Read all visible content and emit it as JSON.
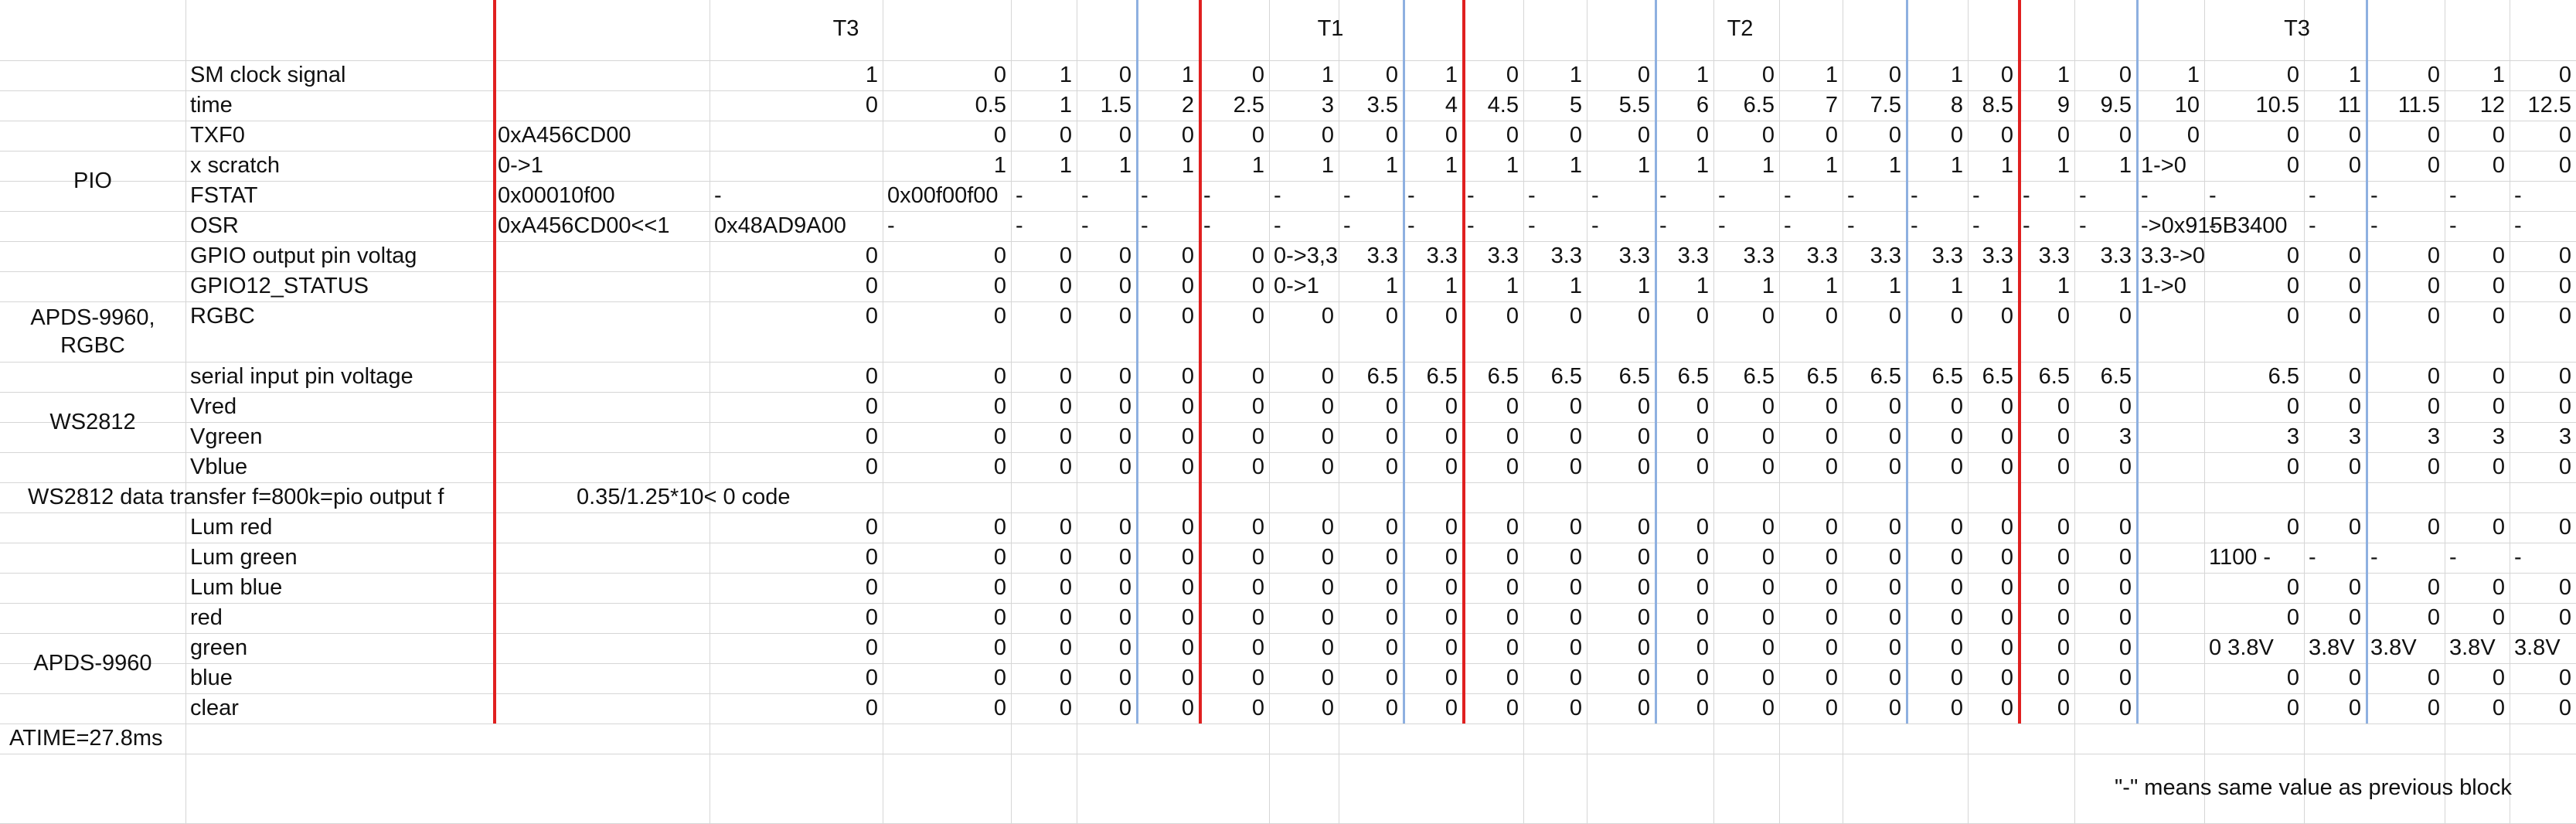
{
  "phases": [
    "T3",
    "T1",
    "T2",
    "T3"
  ],
  "sections": [
    "PIO",
    "APDS-9960,\nRGBC",
    "WS2812",
    "APDS-9960"
  ],
  "rows": [
    {
      "label": "SM clock signal",
      "cells": [
        "",
        "1",
        "0",
        "1",
        "0",
        "1",
        "0",
        "1",
        "0",
        "1",
        "0",
        "1",
        "0",
        "1",
        "0",
        "1",
        "0",
        "1",
        "0",
        "1",
        "0",
        "1",
        "0",
        "1",
        "0",
        "1",
        "0"
      ]
    },
    {
      "label": "time",
      "cells": [
        "",
        "0",
        "0.5",
        "1",
        "1.5",
        "2",
        "2.5",
        "3",
        "3.5",
        "4",
        "4.5",
        "5",
        "5.5",
        "6",
        "6.5",
        "7",
        "7.5",
        "8",
        "8.5",
        "9",
        "9.5",
        "10",
        "10.5",
        "11",
        "11.5",
        "12",
        "12.5"
      ]
    },
    {
      "label": "TXF0",
      "cells": [
        "0xA456CD00",
        "",
        "0",
        "0",
        "0",
        "0",
        "0",
        "0",
        "0",
        "0",
        "0",
        "0",
        "0",
        "0",
        "0",
        "0",
        "0",
        "0",
        "0",
        "0",
        "0",
        "0",
        "0",
        "0",
        "0",
        "0",
        "0"
      ]
    },
    {
      "label": "x  scratch",
      "cells": [
        "0->1",
        "",
        "1",
        "1",
        "1",
        "1",
        "1",
        "1",
        "1",
        "1",
        "1",
        "1",
        "1",
        "1",
        "1",
        "1",
        "1",
        "1",
        "1",
        "1",
        "1",
        "1->0",
        "0",
        "0",
        "0",
        "0",
        "0"
      ]
    },
    {
      "label": "FSTAT",
      "cells": [
        "0x00010f00",
        "-",
        "0x00f00f00",
        "-",
        "-",
        "-",
        "-",
        "-",
        "-",
        "-",
        "-",
        "-",
        "-",
        "-",
        "-",
        "-",
        "-",
        "-",
        "-",
        "-",
        "-",
        "-",
        "-",
        "-",
        "-",
        "-",
        "-"
      ]
    },
    {
      "label": "OSR",
      "cells": [
        "0xA456CD00<<1",
        "0x48AD9A00",
        "-",
        "-",
        "-",
        "-",
        "-",
        "-",
        "-",
        "-",
        "-",
        "-",
        "-",
        "-",
        "-",
        "-",
        "-",
        "-",
        "-",
        "-",
        "-",
        "->0x915B3400",
        "-",
        "-",
        "-",
        "-",
        "-"
      ]
    },
    {
      "label": "GPIO output pin voltag",
      "cells": [
        "",
        "0",
        "0",
        "0",
        "0",
        "0",
        "0",
        "0->3,3",
        "3.3",
        "3.3",
        "3.3",
        "3.3",
        "3.3",
        "3.3",
        "3.3",
        "3.3",
        "3.3",
        "3.3",
        "3.3",
        "3.3",
        "3.3",
        "3.3->0",
        "0",
        "0",
        "0",
        "0",
        "0"
      ]
    },
    {
      "label": "GPIO12_STATUS",
      "cells": [
        "",
        "0",
        "0",
        "0",
        "0",
        "0",
        "0",
        "0->1",
        "1",
        "1",
        "1",
        "1",
        "1",
        "1",
        "1",
        "1",
        "1",
        "1",
        "1",
        "1",
        "1",
        "1->0",
        "0",
        "0",
        "0",
        "0",
        "0"
      ]
    },
    {
      "label": "RGBC",
      "cells": [
        "",
        "0",
        "0",
        "0",
        "0",
        "0",
        "0",
        "0",
        "0",
        "0",
        "0",
        "0",
        "0",
        "0",
        "0",
        "0",
        "0",
        "0",
        "0",
        "0",
        "0",
        "",
        "0",
        "0",
        "0",
        "0",
        "0"
      ]
    },
    {
      "label": "serial input pin voltage",
      "cells": [
        "",
        "0",
        "0",
        "0",
        "0",
        "0",
        "0",
        "0",
        "6.5",
        "6.5",
        "6.5",
        "6.5",
        "6.5",
        "6.5",
        "6.5",
        "6.5",
        "6.5",
        "6.5",
        "6.5",
        "6.5",
        "6.5",
        "",
        "6.5",
        "0",
        "0",
        "0",
        "0"
      ]
    },
    {
      "label": "Vred",
      "cells": [
        "",
        "0",
        "0",
        "0",
        "0",
        "0",
        "0",
        "0",
        "0",
        "0",
        "0",
        "0",
        "0",
        "0",
        "0",
        "0",
        "0",
        "0",
        "0",
        "0",
        "0",
        "",
        "0",
        "0",
        "0",
        "0",
        "0"
      ]
    },
    {
      "label": "Vgreen",
      "cells": [
        "",
        "0",
        "0",
        "0",
        "0",
        "0",
        "0",
        "0",
        "0",
        "0",
        "0",
        "0",
        "0",
        "0",
        "0",
        "0",
        "0",
        "0",
        "0",
        "0",
        "3",
        "",
        "3",
        "3",
        "3",
        "3",
        "3"
      ]
    },
    {
      "label": "Vblue",
      "cells": [
        "",
        "0",
        "0",
        "0",
        "0",
        "0",
        "0",
        "0",
        "0",
        "0",
        "0",
        "0",
        "0",
        "0",
        "0",
        "0",
        "0",
        "0",
        "0",
        "0",
        "0",
        "",
        "0",
        "0",
        "0",
        "0",
        "0"
      ]
    },
    {
      "label": "Lum red",
      "cells": [
        "",
        "0",
        "0",
        "0",
        "0",
        "0",
        "0",
        "0",
        "0",
        "0",
        "0",
        "0",
        "0",
        "0",
        "0",
        "0",
        "0",
        "0",
        "0",
        "0",
        "0",
        "",
        "0",
        "0",
        "0",
        "0",
        "0"
      ]
    },
    {
      "label": "Lum green",
      "cells": [
        "",
        "0",
        "0",
        "0",
        "0",
        "0",
        "0",
        "0",
        "0",
        "0",
        "0",
        "0",
        "0",
        "0",
        "0",
        "0",
        "0",
        "0",
        "0",
        "0",
        "0",
        "",
        "1100 -",
        "-",
        "-",
        "-",
        "-"
      ]
    },
    {
      "label": "Lum blue",
      "cells": [
        "",
        "0",
        "0",
        "0",
        "0",
        "0",
        "0",
        "0",
        "0",
        "0",
        "0",
        "0",
        "0",
        "0",
        "0",
        "0",
        "0",
        "0",
        "0",
        "0",
        "0",
        "",
        "0",
        "0",
        "0",
        "0",
        "0"
      ]
    },
    {
      "label": "red",
      "cells": [
        "",
        "0",
        "0",
        "0",
        "0",
        "0",
        "0",
        "0",
        "0",
        "0",
        "0",
        "0",
        "0",
        "0",
        "0",
        "0",
        "0",
        "0",
        "0",
        "0",
        "0",
        "",
        "0",
        "0",
        "0",
        "0",
        "0"
      ]
    },
    {
      "label": "green",
      "cells": [
        "",
        "0",
        "0",
        "0",
        "0",
        "0",
        "0",
        "0",
        "0",
        "0",
        "0",
        "0",
        "0",
        "0",
        "0",
        "0",
        "0",
        "0",
        "0",
        "0",
        "0",
        "",
        "0 3.8V",
        "3.8V",
        "3.8V",
        "3.8V",
        "3.8V"
      ]
    },
    {
      "label": "blue",
      "cells": [
        "",
        "0",
        "0",
        "0",
        "0",
        "0",
        "0",
        "0",
        "0",
        "0",
        "0",
        "0",
        "0",
        "0",
        "0",
        "0",
        "0",
        "0",
        "0",
        "0",
        "0",
        "",
        "0",
        "0",
        "0",
        "0",
        "0"
      ]
    },
    {
      "label": "clear",
      "cells": [
        "",
        "0",
        "0",
        "0",
        "0",
        "0",
        "0",
        "0",
        "0",
        "0",
        "0",
        "0",
        "0",
        "0",
        "0",
        "0",
        "0",
        "0",
        "0",
        "0",
        "0",
        "",
        "0",
        "0",
        "0",
        "0",
        "0"
      ]
    }
  ],
  "ws2812_transfer": {
    "label": "WS2812 data transfer f=800k=pio output f",
    "formula": "0.35/1.25*10< 0 code"
  },
  "atime": "ATIME=27.8ms",
  "footnote": "\"-\" means same value as previous block",
  "colors": {
    "grid": "#d6d6d6",
    "phase_divider": "#e02020",
    "block_divider": "#8eb0e0"
  }
}
